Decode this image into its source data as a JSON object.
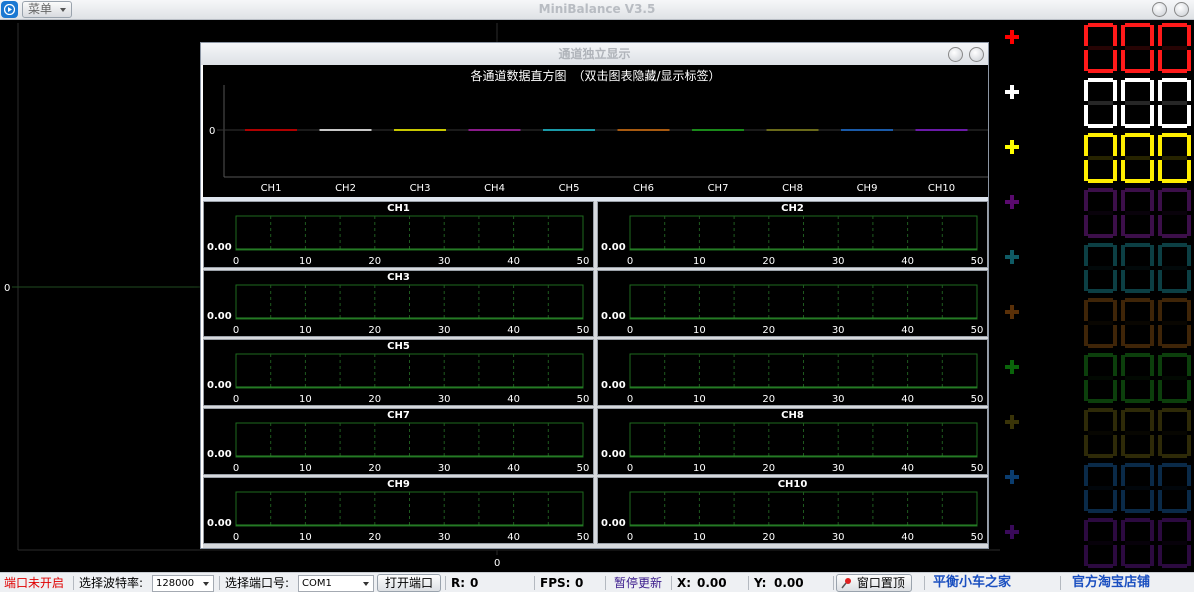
{
  "app": {
    "title": "MiniBalance V3.5",
    "menu_label": "菜单"
  },
  "main_plot": {
    "y_zero_label": "0",
    "x_zero_label": "0"
  },
  "channel_colors": [
    "#ff0000",
    "#ffffff",
    "#ffff00",
    "#5a0a6e",
    "#0f5a64",
    "#5a3008",
    "#0a640a",
    "#3a3408",
    "#0a3c6e",
    "#3a0a5a"
  ],
  "digit_displays": {
    "value": "000",
    "active_colors": [
      "#ff1a1a",
      "#ffffff",
      "#ffee00"
    ],
    "dim_colors": [
      "#3c0f4a",
      "#0c3f44",
      "#3f2508",
      "#0c3f0c",
      "#2e2a08",
      "#0a2a48",
      "#2c0a40"
    ]
  },
  "dialog": {
    "title": "通道独立显示",
    "histogram": {
      "title": "各通道数据直方图　（双击图表隐藏/显示标签）",
      "y_label": "0",
      "channels": [
        "CH1",
        "CH2",
        "CH3",
        "CH4",
        "CH5",
        "CH6",
        "CH7",
        "CH8",
        "CH9",
        "CH10"
      ],
      "bar_colors": [
        "#b00000",
        "#c8c8c8",
        "#c8c800",
        "#8a1a8a",
        "#1a9aa8",
        "#a85a10",
        "#1a8a1a",
        "#6a6a1a",
        "#1a5aa8",
        "#6a1aa8"
      ]
    },
    "panels": [
      {
        "title": "CH1",
        "value": "0.00"
      },
      {
        "title": "CH2",
        "value": "0.00"
      },
      {
        "title": "CH3",
        "value": "0.00"
      },
      {
        "title": "",
        "value": "0.00"
      },
      {
        "title": "CH5",
        "value": "0.00"
      },
      {
        "title": "",
        "value": "0.00"
      },
      {
        "title": "CH7",
        "value": "0.00"
      },
      {
        "title": "CH8",
        "value": "0.00"
      },
      {
        "title": "CH9",
        "value": "0.00"
      },
      {
        "title": "CH10",
        "value": "0.00"
      }
    ],
    "x_ticks": [
      "0",
      "10",
      "20",
      "30",
      "40",
      "50"
    ]
  },
  "statusbar": {
    "port_status": "端口未开启",
    "baud_label": "选择波特率:",
    "baud_value": "128000",
    "port_label": "选择端口号:",
    "port_value": "COM1",
    "open_port_button": "打开端口",
    "r_label": "R:",
    "r_value": "0",
    "fps_label": "FPS:",
    "fps_value": "0",
    "pause_label": "暂停更新",
    "x_label": "X:",
    "x_value": "0.00",
    "y_label": "Y:",
    "y_value": "0.00",
    "pin_label": "窗口置顶",
    "link1": "平衡小车之家",
    "link2": "官方淘宝店铺"
  }
}
